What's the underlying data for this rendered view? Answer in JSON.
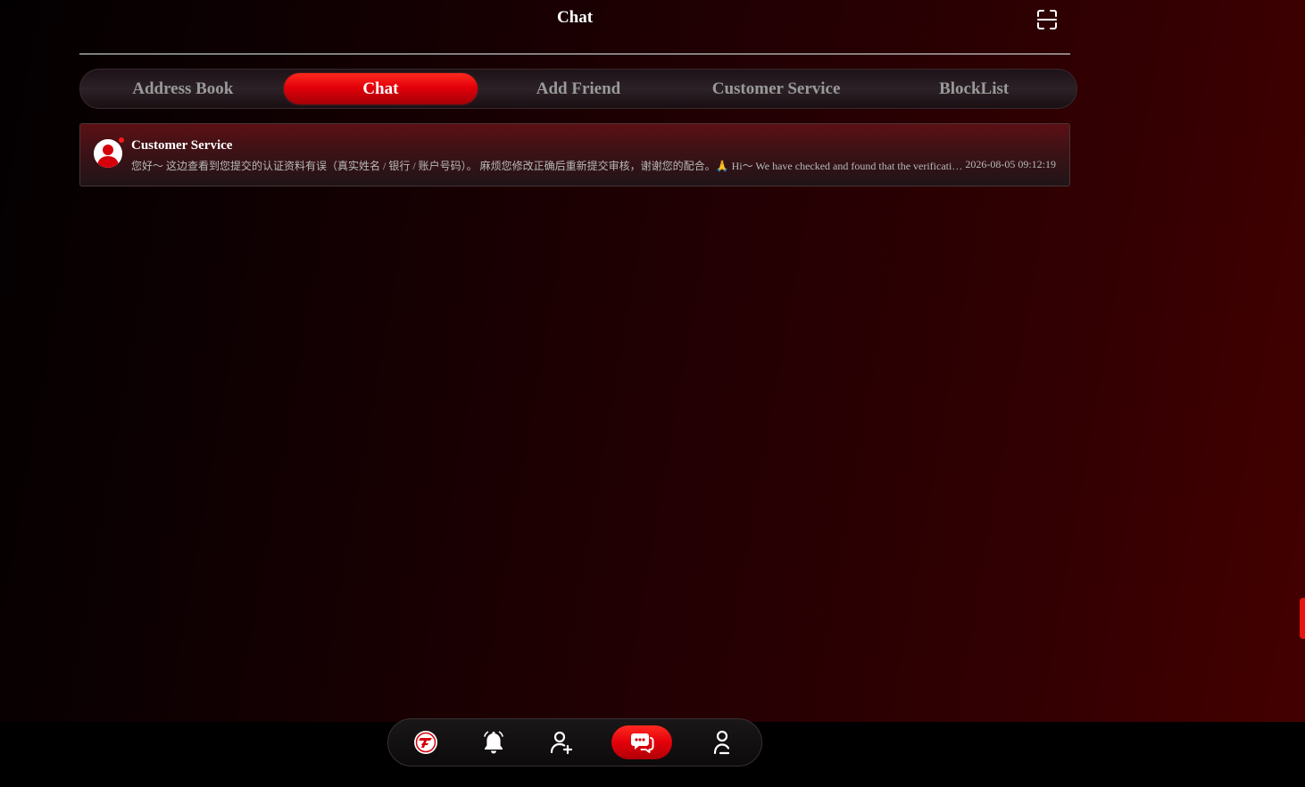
{
  "header": {
    "title": "Chat",
    "scan_icon": "scan-icon"
  },
  "tabs": [
    {
      "label": "Address Book",
      "active": false
    },
    {
      "label": "Chat",
      "active": true
    },
    {
      "label": "Add Friend",
      "active": false
    },
    {
      "label": "Customer Service",
      "active": false
    },
    {
      "label": "BlockList",
      "active": false
    }
  ],
  "conversations": [
    {
      "name": "Customer Service",
      "preview": "您好～ 这边查看到您提交的认证资料有误（真实姓名 / 银行 / 账户号码）。 麻烦您修改正确后重新提交审核，谢谢您的配合。🙏 Hi～ We have checked and found that the verification information you submitted is incorrect",
      "time": "2026-08-05 09:12:19",
      "unread": true,
      "avatar_icon": "user-avatar-icon"
    }
  ],
  "bottom_nav": [
    {
      "name": "home",
      "icon": "brand-logo-icon",
      "active": false
    },
    {
      "name": "notifications",
      "icon": "bell-icon",
      "active": false
    },
    {
      "name": "add-friend",
      "icon": "add-user-icon",
      "active": false
    },
    {
      "name": "chat",
      "icon": "chat-bubbles-icon",
      "active": true
    },
    {
      "name": "profile",
      "icon": "user-icon",
      "active": false
    }
  ],
  "colors": {
    "accent": "#e3000a",
    "unread_dot": "#ff1a1a",
    "text_muted": "#9a9a9a"
  }
}
